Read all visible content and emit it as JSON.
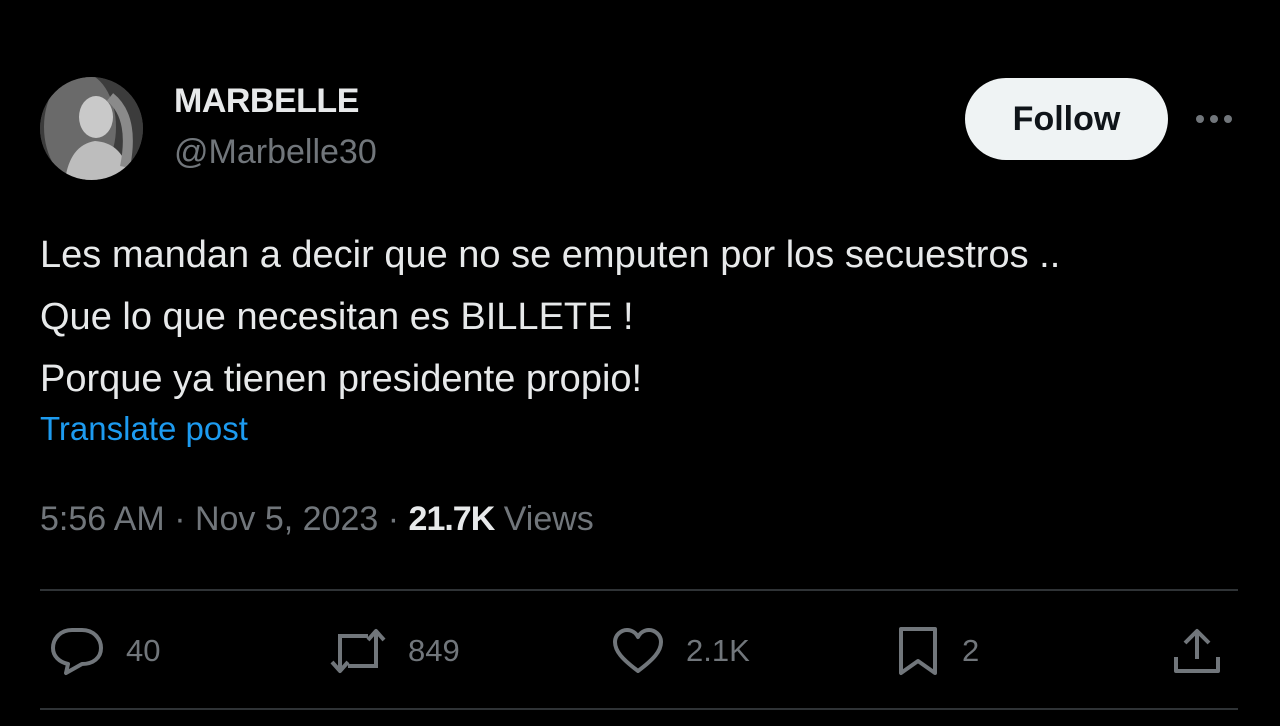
{
  "author": {
    "display_name": "MARBELLE",
    "handle": "@Marbelle30"
  },
  "follow_label": "Follow",
  "tweet": {
    "lines": [
      "Les mandan a decir que no se emputen por los secuestros ..",
      "Que lo que necesitan es BILLETE !",
      "Porque ya tienen presidente propio!"
    ]
  },
  "translate_label": "Translate post",
  "meta": {
    "time": "5:56 AM",
    "sep1": " · ",
    "date": "Nov 5, 2023",
    "sep2": " · ",
    "views_count": "21.7K",
    "views_label": " Views"
  },
  "actions": {
    "replies": "40",
    "reposts": "849",
    "likes": "2.1K",
    "bookmarks": "2"
  },
  "icons": {
    "avatar": "profile-photo",
    "more": "more-horizontal-icon",
    "reply": "reply-icon",
    "repost": "repost-icon",
    "like": "heart-icon",
    "bookmark": "bookmark-icon",
    "share": "share-icon"
  },
  "colors": {
    "background": "#000000",
    "text": "#e7e9ea",
    "secondary": "#71767b",
    "link": "#1d9bf0",
    "follow_bg": "#eff3f4",
    "divider": "#2f3336"
  }
}
